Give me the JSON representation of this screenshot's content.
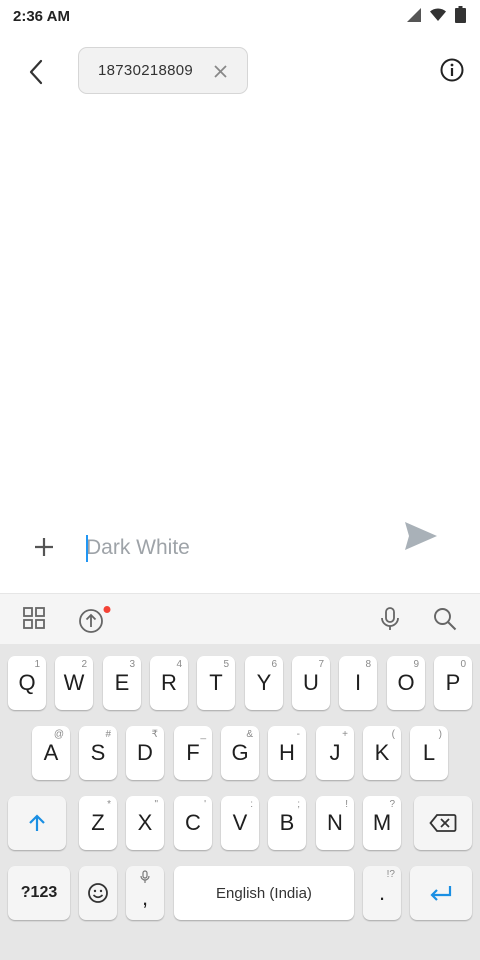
{
  "status_bar": {
    "time": "2:36 AM",
    "icons": [
      "signal-icon",
      "wifi-icon",
      "battery-icon"
    ]
  },
  "header": {
    "back_icon": "back-arrow-icon",
    "recipient": "18730218809",
    "chip_close_icon": "close-icon",
    "info_icon": "info-icon"
  },
  "compose": {
    "add_icon": "plus-icon",
    "placeholder": "Dark White",
    "value": "",
    "send_icon": "send-icon"
  },
  "keyboard_toolbar": {
    "icons": [
      "apps-grid-icon",
      "upload-icon",
      "mic-icon",
      "search-icon"
    ],
    "notification_dot_color": "#f44336"
  },
  "keyboard": {
    "row1": [
      {
        "label": "Q",
        "hint": "1"
      },
      {
        "label": "W",
        "hint": "2"
      },
      {
        "label": "E",
        "hint": "3"
      },
      {
        "label": "R",
        "hint": "4"
      },
      {
        "label": "T",
        "hint": "5"
      },
      {
        "label": "Y",
        "hint": "6"
      },
      {
        "label": "U",
        "hint": "7"
      },
      {
        "label": "I",
        "hint": "8"
      },
      {
        "label": "O",
        "hint": "9"
      },
      {
        "label": "P",
        "hint": "0"
      }
    ],
    "row2": [
      {
        "label": "A",
        "hint": "@"
      },
      {
        "label": "S",
        "hint": "#"
      },
      {
        "label": "D",
        "hint": "₹"
      },
      {
        "label": "F",
        "hint": "_"
      },
      {
        "label": "G",
        "hint": "&"
      },
      {
        "label": "H",
        "hint": "-"
      },
      {
        "label": "J",
        "hint": "+"
      },
      {
        "label": "K",
        "hint": "("
      },
      {
        "label": "L",
        "hint": ")"
      }
    ],
    "row3": [
      {
        "label": "Z",
        "hint": "*"
      },
      {
        "label": "X",
        "hint": "\""
      },
      {
        "label": "C",
        "hint": "'"
      },
      {
        "label": "V",
        "hint": ":"
      },
      {
        "label": "B",
        "hint": ";"
      },
      {
        "label": "N",
        "hint": "!"
      },
      {
        "label": "M",
        "hint": "?"
      }
    ],
    "shift_icon": "shift-arrow-icon",
    "backspace_icon": "backspace-icon",
    "symbols_label": "?123",
    "emoji_icon": "emoji-icon",
    "comma_label": ",",
    "space_label": "English (India)",
    "period_label": ".",
    "period_hint": "!?",
    "enter_icon": "enter-icon",
    "accent_color": "#1a8fe3"
  }
}
